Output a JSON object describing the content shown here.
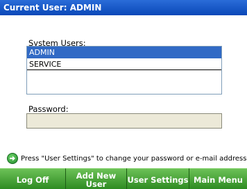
{
  "header": {
    "title": "Current User: ADMIN"
  },
  "users": {
    "label": "System Users:",
    "items": [
      {
        "name": "ADMIN",
        "selected": true
      },
      {
        "name": "SERVICE",
        "selected": false
      }
    ]
  },
  "password": {
    "label": "Password:",
    "value": ""
  },
  "hint": {
    "icon": "green-arrow-icon",
    "text": "Press \"User Settings\" to change your password or e-mail address"
  },
  "buttons": {
    "log_off": "Log Off",
    "add_new_user": "Add New User",
    "user_settings": "User Settings",
    "main_menu": "Main Menu"
  },
  "colors": {
    "title_bar": "#0a48b8",
    "selection": "#316ac5",
    "button_green": "#3a8a2a",
    "password_bg": "#ece9d8"
  }
}
